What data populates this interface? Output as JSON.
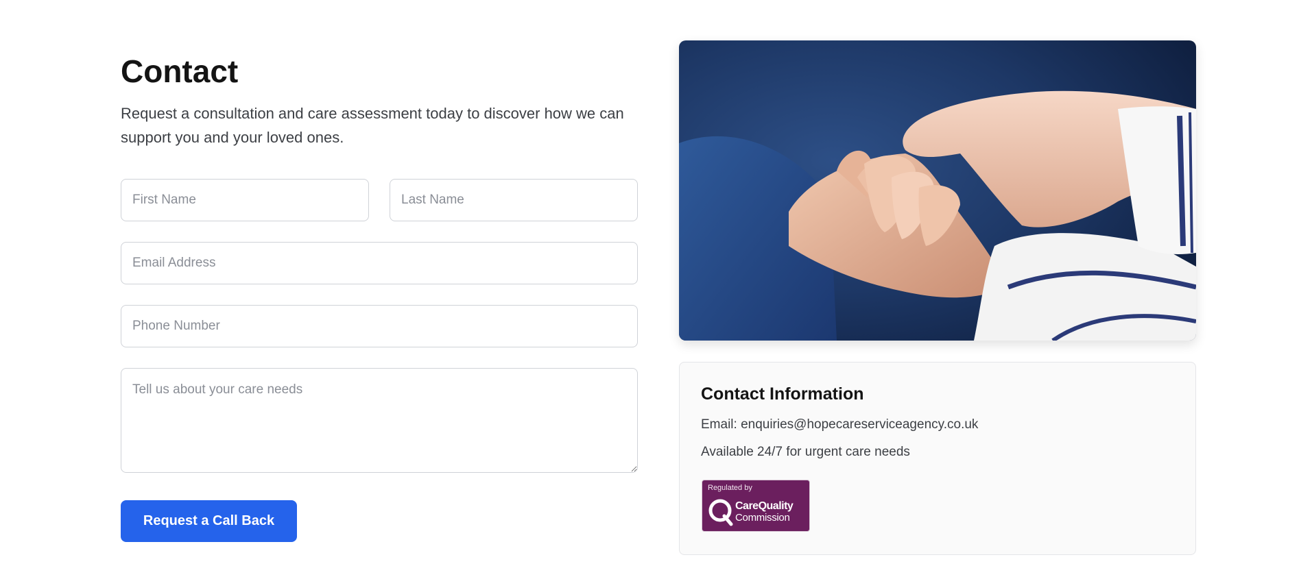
{
  "contact": {
    "title": "Contact",
    "subtitle": "Request a consultation and care assessment today to discover how we can support you and your loved ones."
  },
  "form": {
    "first_name": {
      "placeholder": "First Name",
      "value": ""
    },
    "last_name": {
      "placeholder": "Last Name",
      "value": ""
    },
    "email": {
      "placeholder": "Email Address",
      "value": ""
    },
    "phone": {
      "placeholder": "Phone Number",
      "value": ""
    },
    "care_needs": {
      "placeholder": "Tell us about your care needs",
      "value": ""
    },
    "submit_label": "Request a Call Back"
  },
  "photo": {
    "description_icon": "hands-holding-photo"
  },
  "info": {
    "title": "Contact Information",
    "email_line": "Email: enquiries@hopecareserviceagency.co.uk",
    "availability": "Available 24/7 for urgent care needs",
    "badge": {
      "top": "Regulated by",
      "name_line1": "CareQuality",
      "name_line2": "Commission"
    }
  },
  "colors": {
    "accent": "#2563eb",
    "badge": "#6b1f5e"
  }
}
